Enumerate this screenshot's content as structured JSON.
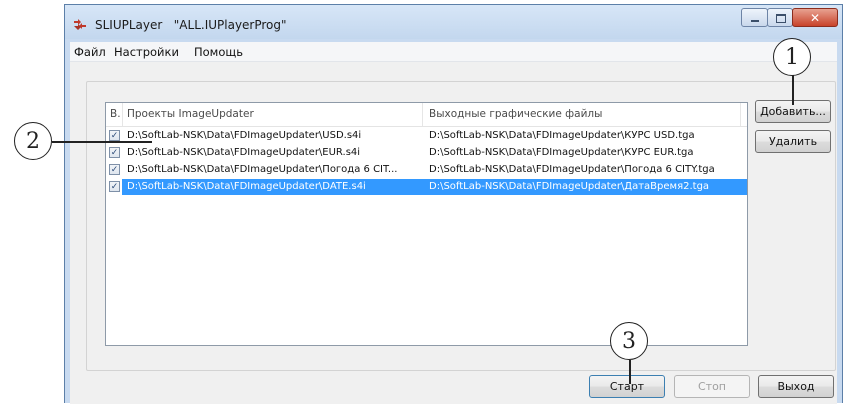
{
  "window": {
    "title_app": "SLIUPLayer",
    "title_doc": "\"ALL.IUPlayerProg\"",
    "icon": "red-arrows-app-icon"
  },
  "menu": [
    "Файл",
    "Настройки",
    "Помощь"
  ],
  "list": {
    "columns": [
      "В.",
      "Проекты ImageUpdater",
      "Выходные графические файлы"
    ],
    "rows": [
      {
        "checked": true,
        "project": "D:\\SoftLab-NSK\\Data\\FDImageUpdater\\USD.s4i",
        "output": "D:\\SoftLab-NSK\\Data\\FDImageUpdater\\КУРС USD.tga",
        "selected": false
      },
      {
        "checked": true,
        "project": "D:\\SoftLab-NSK\\Data\\FDImageUpdater\\EUR.s4i",
        "output": "D:\\SoftLab-NSK\\Data\\FDImageUpdater\\КУРС EUR.tga",
        "selected": false
      },
      {
        "checked": true,
        "project": "D:\\SoftLab-NSK\\Data\\FDImageUpdater\\Погода 6 CIT...",
        "output": "D:\\SoftLab-NSK\\Data\\FDImageUpdater\\Погода 6 CITY.tga",
        "selected": false
      },
      {
        "checked": true,
        "project": "D:\\SoftLab-NSK\\Data\\FDImageUpdater\\DATE.s4i",
        "output": "D:\\SoftLab-NSK\\Data\\FDImageUpdater\\ДатаВремя2.tga",
        "selected": true
      }
    ]
  },
  "buttons": {
    "add": "Добавить...",
    "remove": "Удалить",
    "start": "Старт",
    "stop": "Стоп",
    "exit": "Выход"
  },
  "callouts": {
    "c1": "1",
    "c2": "2",
    "c3": "3"
  },
  "colors": {
    "selection": "#3399ff",
    "close_button": "#c8432a"
  }
}
